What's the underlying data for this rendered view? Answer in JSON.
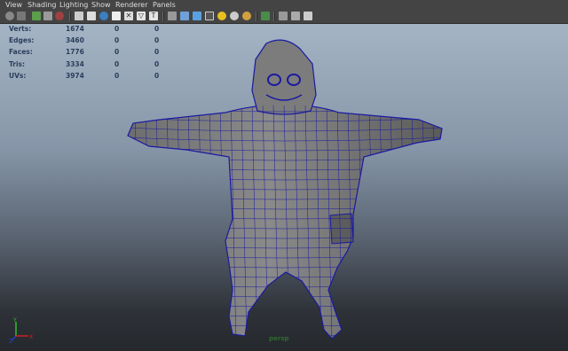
{
  "menu": [
    "View",
    "Shading",
    "Lighting",
    "Show",
    "Renderer",
    "Panels"
  ],
  "hud": {
    "rows": [
      {
        "label": "Verts:",
        "value": "1674",
        "c2": "0",
        "c3": "0"
      },
      {
        "label": "Edges:",
        "value": "3460",
        "c2": "0",
        "c3": "0"
      },
      {
        "label": "Faces:",
        "value": "1776",
        "c2": "0",
        "c3": "0"
      },
      {
        "label": "Tris:",
        "value": "3334",
        "c2": "0",
        "c3": "0"
      },
      {
        "label": "UVs:",
        "value": "3974",
        "c2": "0",
        "c3": "0"
      }
    ]
  },
  "camera": "persp",
  "axes": {
    "y": "Y",
    "x": "X",
    "z": "Z"
  },
  "colors": {
    "wireframe": "#1a1aa0",
    "hud_text": "#2a3d5c",
    "camera_label": "#2f6a2f"
  }
}
